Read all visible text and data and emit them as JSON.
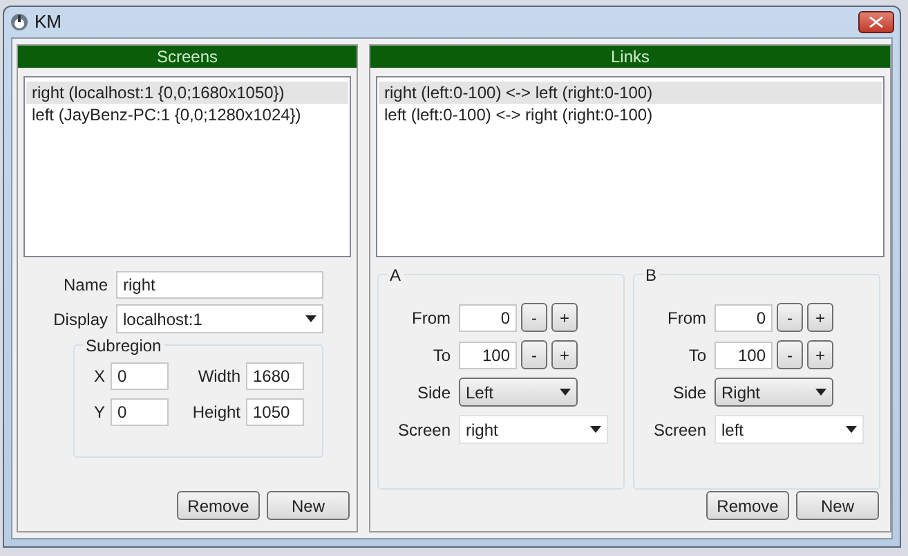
{
  "window": {
    "title": "KM"
  },
  "screens": {
    "title": "Screens",
    "items": [
      {
        "label": "right (localhost:1 {0,0;1680x1050})",
        "selected": true
      },
      {
        "label": "left (JayBenz-PC:1 {0,0;1280x1024})",
        "selected": false
      }
    ],
    "name": {
      "label": "Name",
      "value": "right"
    },
    "display": {
      "label": "Display",
      "value": "localhost:1"
    },
    "subregion": {
      "title": "Subregion",
      "fields": [
        {
          "label": "X",
          "value": "0"
        },
        {
          "label": "Width",
          "value": "1680"
        },
        {
          "label": "Y",
          "value": "0"
        },
        {
          "label": "Height",
          "value": "1050"
        }
      ]
    },
    "buttons": [
      "Remove",
      "New"
    ]
  },
  "links": {
    "title": "Links",
    "items": [
      {
        "label": "right (left:0-100) <-> left (right:0-100)",
        "selected": true
      },
      {
        "label": "left (left:0-100) <-> right (right:0-100)",
        "selected": false
      }
    ],
    "ends": [
      {
        "title": "A",
        "steppers": [
          {
            "label": "From",
            "value": "0",
            "buttons": [
              "-",
              "+"
            ]
          },
          {
            "label": "To",
            "value": "100",
            "buttons": [
              "-",
              "+"
            ]
          }
        ],
        "side": {
          "label": "Side",
          "value": "Left"
        },
        "screen": {
          "label": "Screen",
          "value": "right"
        }
      },
      {
        "title": "B",
        "steppers": [
          {
            "label": "From",
            "value": "0",
            "buttons": [
              "-",
              "+"
            ]
          },
          {
            "label": "To",
            "value": "100",
            "buttons": [
              "-",
              "+"
            ]
          }
        ],
        "side": {
          "label": "Side",
          "value": "Right"
        },
        "screen": {
          "label": "Screen",
          "value": "left"
        }
      }
    ],
    "buttons": [
      "Remove",
      "New"
    ]
  }
}
